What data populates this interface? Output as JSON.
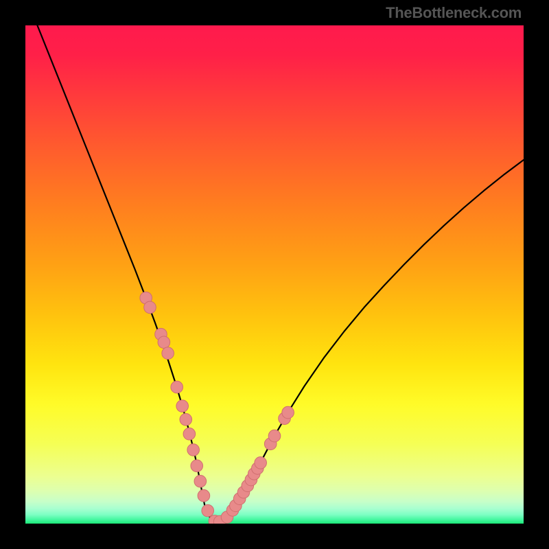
{
  "attribution": "TheBottleneck.com",
  "colors": {
    "bg": "#000000",
    "curve": "#000000",
    "dot_fill": "#e88a8a",
    "dot_stroke": "#d06f6f",
    "grad_stops": [
      {
        "o": 0.0,
        "c": "#ff1a4d"
      },
      {
        "o": 0.06,
        "c": "#ff2048"
      },
      {
        "o": 0.14,
        "c": "#ff3a3c"
      },
      {
        "o": 0.24,
        "c": "#ff5a2e"
      },
      {
        "o": 0.36,
        "c": "#ff7e1f"
      },
      {
        "o": 0.48,
        "c": "#ffa114"
      },
      {
        "o": 0.58,
        "c": "#ffc20e"
      },
      {
        "o": 0.68,
        "c": "#ffe40f"
      },
      {
        "o": 0.76,
        "c": "#fffb28"
      },
      {
        "o": 0.84,
        "c": "#f5ff55"
      },
      {
        "o": 0.905,
        "c": "#ecff90"
      },
      {
        "o": 0.935,
        "c": "#ddffb0"
      },
      {
        "o": 0.955,
        "c": "#c8ffc8"
      },
      {
        "o": 0.97,
        "c": "#a8ffd0"
      },
      {
        "o": 0.982,
        "c": "#7dffc4"
      },
      {
        "o": 0.992,
        "c": "#45f7a0"
      },
      {
        "o": 1.0,
        "c": "#1be877"
      }
    ]
  },
  "chart_data": {
    "type": "line",
    "title": "",
    "xlabel": "",
    "ylabel": "",
    "xlim": [
      0,
      100
    ],
    "ylim": [
      0,
      100
    ],
    "series": [
      {
        "name": "curve",
        "x": [
          0,
          3,
          6,
          9,
          12,
          15,
          18,
          20,
          22,
          24,
          26,
          28,
          30,
          31,
          32,
          33,
          34,
          34.5,
          35,
          35.5,
          36,
          36.8,
          37.5,
          38.5,
          40,
          42,
          44,
          46,
          48,
          50,
          53,
          56,
          60,
          64,
          68,
          72,
          76,
          80,
          84,
          88,
          92,
          96,
          100
        ],
        "y": [
          106,
          98.5,
          91,
          83.5,
          76,
          68.5,
          61,
          56,
          51,
          45.8,
          40.4,
          34.8,
          28.6,
          25.3,
          21.8,
          18,
          13.8,
          11.4,
          8.8,
          6.1,
          3.6,
          1.6,
          0.6,
          0.35,
          0.9,
          3.2,
          6.4,
          10,
          13.8,
          17.6,
          22.8,
          27.6,
          33.4,
          38.6,
          43.4,
          47.8,
          52,
          56,
          59.8,
          63.4,
          66.8,
          70,
          73
        ]
      },
      {
        "name": "dots-left",
        "x": [
          24.2,
          25.0,
          27.2,
          27.8,
          28.6,
          30.4,
          31.5,
          32.2,
          32.9,
          33.7,
          34.4,
          35.1
        ],
        "y": [
          45.3,
          43.4,
          38.0,
          36.4,
          34.2,
          27.4,
          23.6,
          20.9,
          18.0,
          14.8,
          11.6,
          8.5
        ]
      },
      {
        "name": "dots-bottom",
        "x": [
          35.8,
          36.6,
          38.0,
          39.0,
          40.5,
          41.6
        ],
        "y": [
          5.6,
          2.6,
          0.5,
          0.4,
          1.3,
          2.7
        ]
      },
      {
        "name": "dots-right",
        "x": [
          42.2,
          43.0,
          43.8,
          44.6,
          45.3,
          45.9,
          46.6,
          47.2,
          49.2,
          50.0,
          52.0,
          52.7
        ],
        "y": [
          3.6,
          5.0,
          6.3,
          7.6,
          8.8,
          10.0,
          11.1,
          12.2,
          16.0,
          17.6,
          21.1,
          22.3
        ]
      }
    ]
  }
}
